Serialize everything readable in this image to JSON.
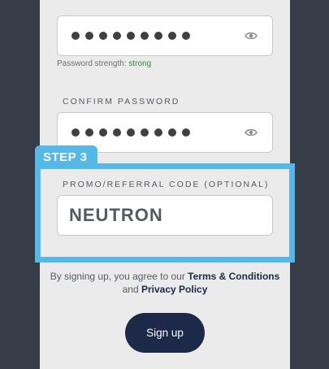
{
  "password": {
    "masked_dots": 9,
    "strength_label": "Password strength: ",
    "strength_value": "strong",
    "strength_color": "#2f8a3f",
    "toggle_icon": "eye-icon"
  },
  "confirm_password": {
    "label": "CONFIRM PASSWORD",
    "masked_dots": 9,
    "toggle_icon": "eye-icon"
  },
  "step": {
    "label": "STEP 3",
    "color": "#56b8e7"
  },
  "promo": {
    "label": "PROMO/REFERRAL CODE (OPTIONAL)",
    "value": "NEUTRON"
  },
  "terms": {
    "prefix": "By signing up, you agree to our ",
    "terms_link": "Terms & Conditions",
    "conjunction": " and ",
    "privacy_link": "Privacy Policy"
  },
  "signup": {
    "label": "Sign up",
    "color": "#1c2948"
  }
}
